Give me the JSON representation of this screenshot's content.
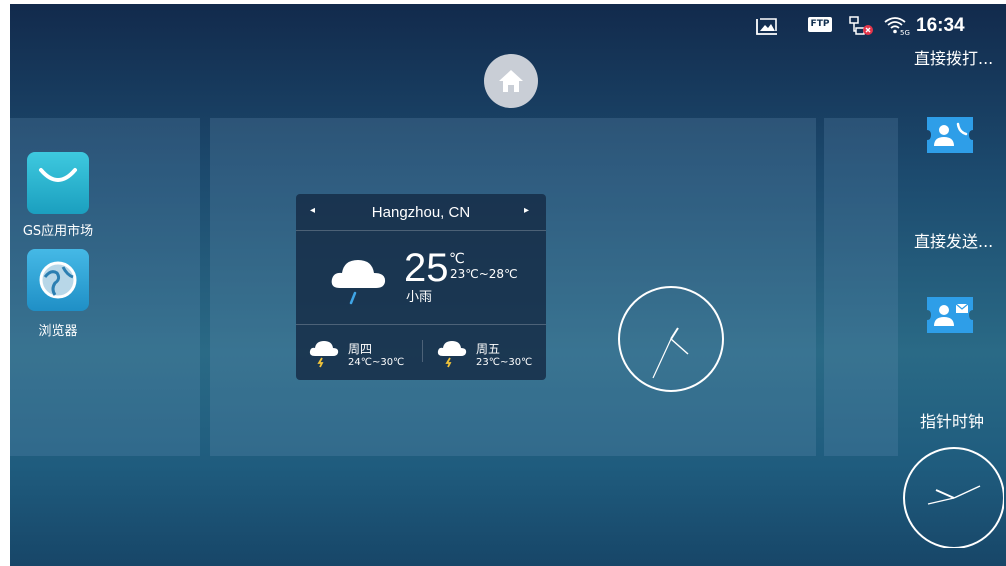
{
  "status_bar": {
    "time": "16:34",
    "ftp_label": "FTP",
    "icons": [
      "picture-icon",
      "ftp-icon",
      "network-disconnected-icon",
      "wifi-5g-icon"
    ]
  },
  "home": {
    "icon": "home-icon"
  },
  "apps": [
    {
      "label": "GS应用市场",
      "icon": "market-bag-icon",
      "color": "#23b5cf"
    },
    {
      "label": "浏览器",
      "icon": "globe-icon",
      "color": "#2aa6d6"
    }
  ],
  "weather": {
    "city": "Hangzhou, CN",
    "prev_arrow": "◂",
    "next_arrow": "▸",
    "temperature": "25",
    "unit": "℃",
    "range": "23℃~28℃",
    "condition": "小雨",
    "forecast": [
      {
        "day": "周四",
        "range": "24℃~30℃"
      },
      {
        "day": "周五",
        "range": "23℃~30℃"
      }
    ]
  },
  "shortcuts": [
    {
      "label": "直接拨打...",
      "icon": "direct-dial-icon"
    },
    {
      "label": "直接发送...",
      "icon": "direct-message-icon"
    },
    {
      "label": "指针时钟",
      "icon": "analog-clock-icon"
    }
  ]
}
